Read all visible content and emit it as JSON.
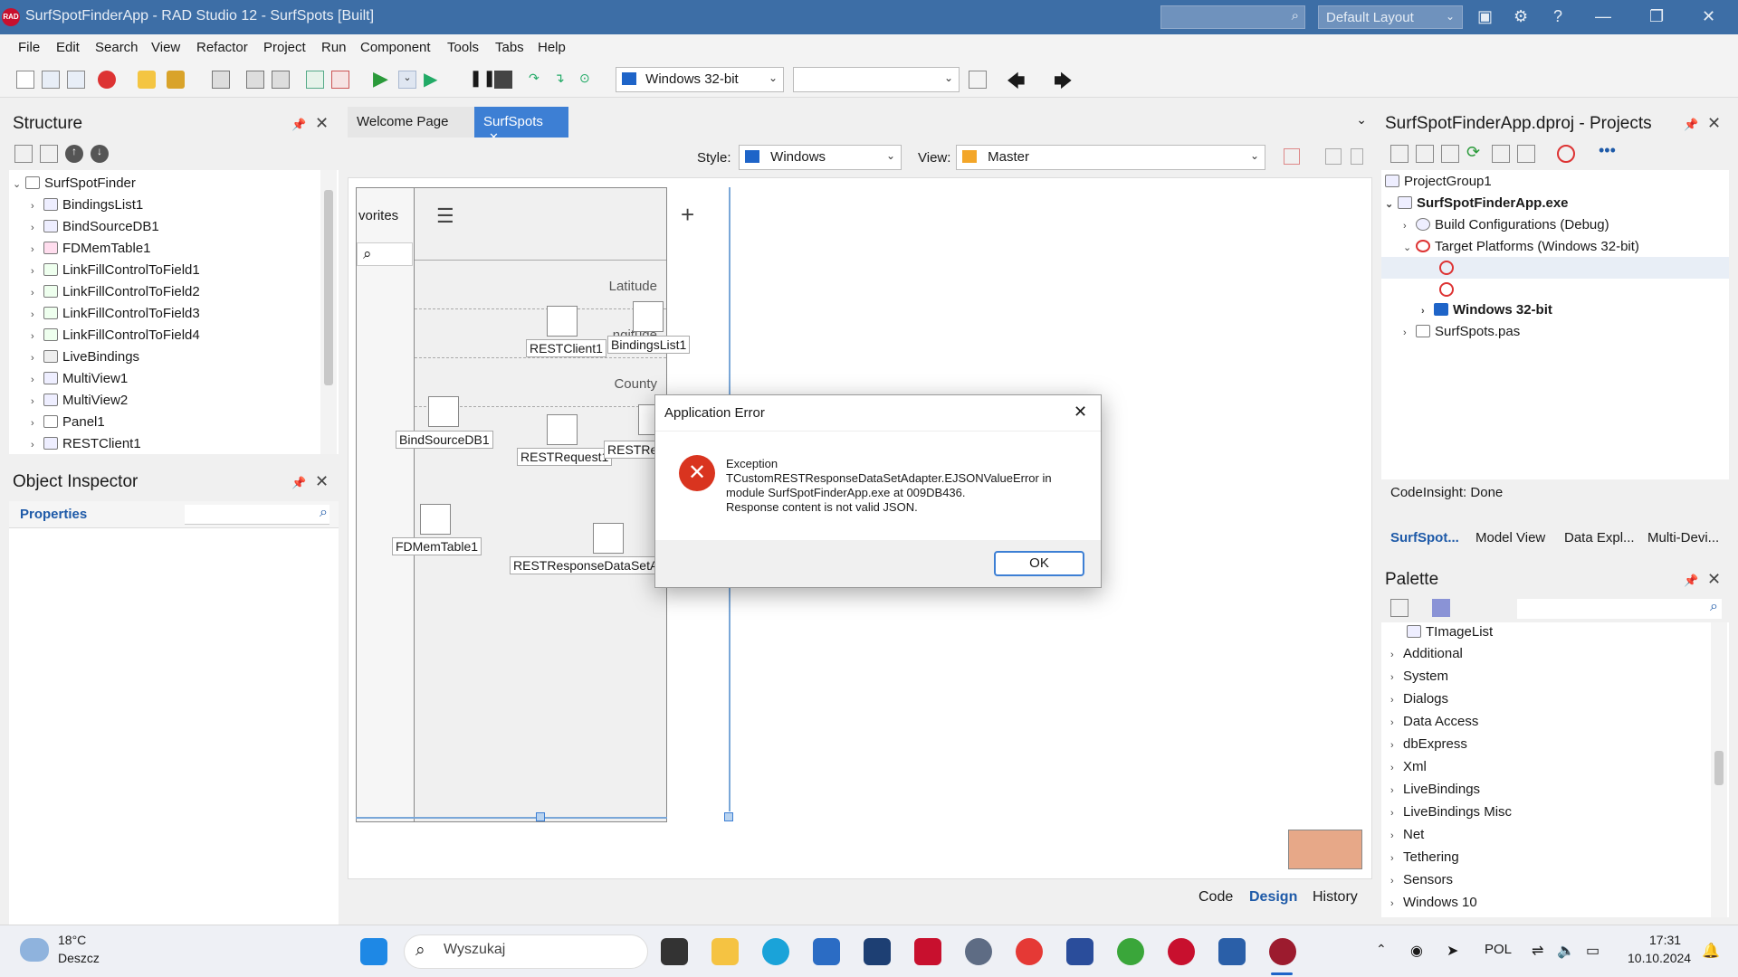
{
  "window": {
    "title": "SurfSpotFinderApp - RAD Studio 12 - SurfSpots [Built]",
    "logo": "RAD",
    "layout": "Default Layout"
  },
  "menu": [
    "File",
    "Edit",
    "Search",
    "View",
    "Refactor",
    "Project",
    "Run",
    "Component",
    "Tools",
    "Tabs",
    "Help"
  ],
  "toolbar": {
    "platform": "Windows 32-bit",
    "config": ""
  },
  "structure": {
    "title": "Structure",
    "root": "SurfSpotFinder",
    "items": [
      "BindingsList1",
      "BindSourceDB1",
      "FDMemTable1",
      "LinkFillControlToField1",
      "LinkFillControlToField2",
      "LinkFillControlToField3",
      "LinkFillControlToField4",
      "LiveBindings",
      "MultiView1",
      "MultiView2",
      "Panel1",
      "RESTClient1"
    ]
  },
  "inspector": {
    "title": "Object Inspector",
    "tab": "Properties"
  },
  "editor": {
    "tabs": [
      "Welcome Page",
      "SurfSpots"
    ],
    "style_label": "Style:",
    "style_value": "Windows",
    "view_label": "View:",
    "view_value": "Master",
    "form": {
      "favorites": "vorites",
      "latitude": "Latitude",
      "longitude": "ngitude",
      "county": "County"
    },
    "components": [
      "RESTClient1",
      "BindingsList1",
      "BindSourceDB1",
      "RESTRequest1",
      "RESTRes",
      "FDMemTable1",
      "RESTResponseDataSetA"
    ],
    "bottom_tabs": [
      "Code",
      "Design",
      "History"
    ]
  },
  "dialog": {
    "title": "Application Error",
    "line1": "Exception",
    "line2": "TCustomRESTResponseDataSetAdapter.EJSONValueError in",
    "line3": "module SurfSpotFinderApp.exe at 009DB436.",
    "line4": "Response content is not valid JSON.",
    "ok": "OK"
  },
  "projects": {
    "title": "SurfSpotFinderApp.dproj - Projects",
    "group": "ProjectGroup1",
    "exe": "SurfSpotFinderApp.exe",
    "build": "Build Configurations (Debug)",
    "targets": "Target Platforms (Windows 32-bit)",
    "win32": "Windows 32-bit",
    "pas": "SurfSpots.pas",
    "status": "CodeInsight: Done",
    "tabs": [
      "SurfSpot...",
      "Model View",
      "Data Expl...",
      "Multi-Devi..."
    ]
  },
  "palette": {
    "title": "Palette",
    "items": [
      "TImageList",
      "Additional",
      "System",
      "Dialogs",
      "Data Access",
      "dbExpress",
      "Xml",
      "LiveBindings",
      "LiveBindings Misc",
      "Net",
      "Tethering",
      "Sensors",
      "Windows 10"
    ]
  },
  "taskbar": {
    "temp": "18°C",
    "weather": "Deszcz",
    "search": "Wyszukaj",
    "lang": "POL",
    "time": "17:31",
    "date": "10.10.2024"
  }
}
